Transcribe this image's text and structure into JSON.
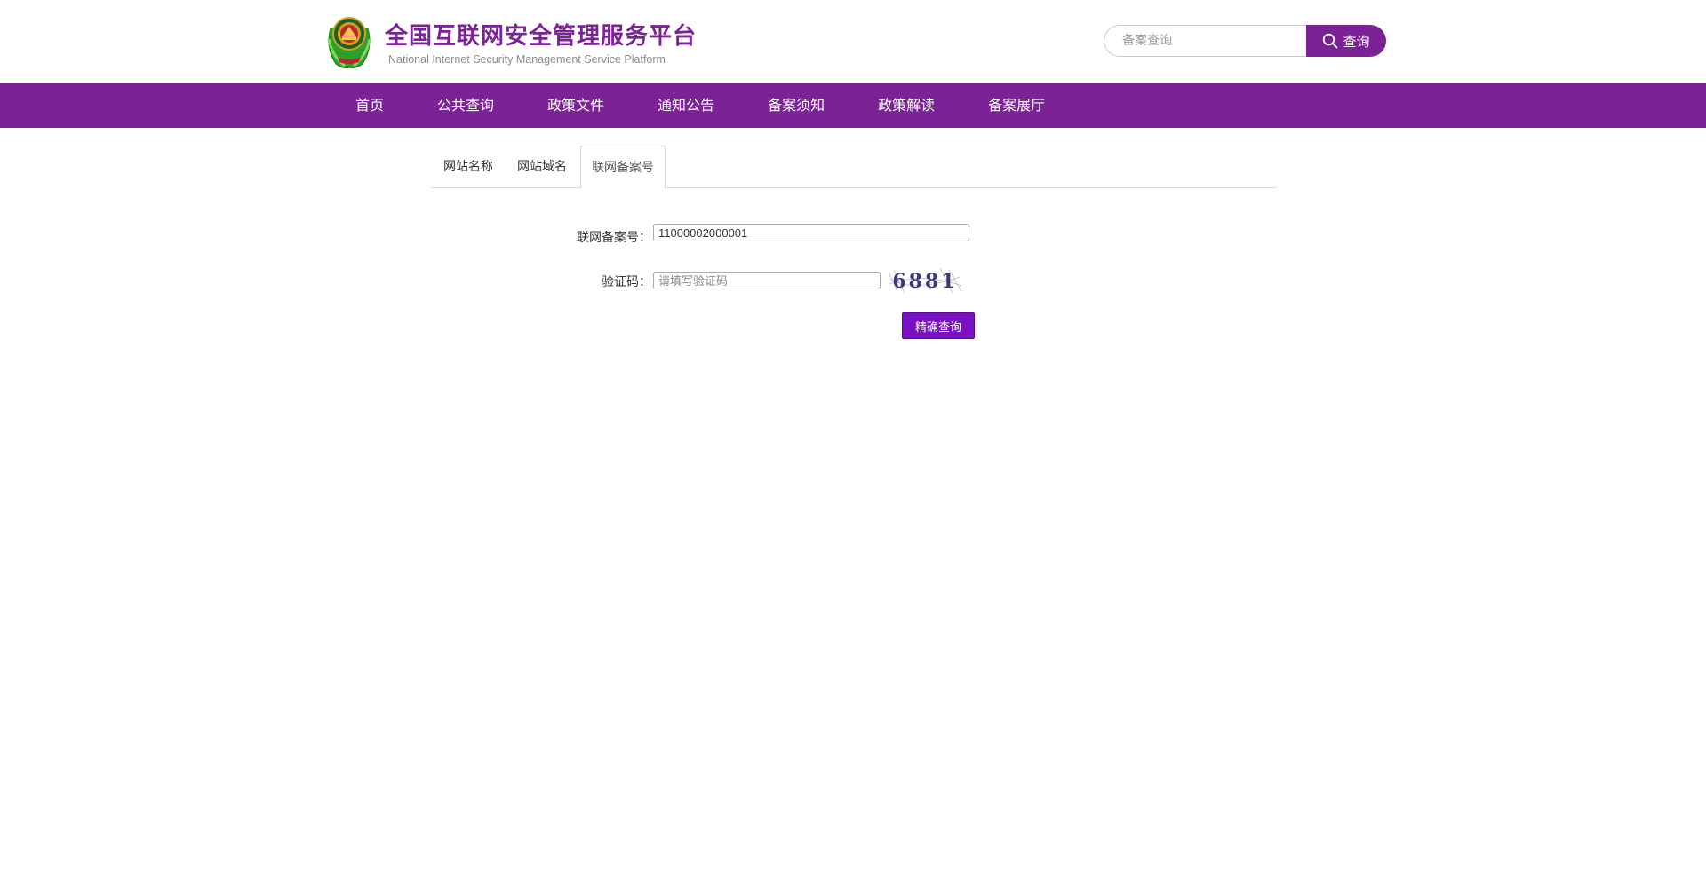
{
  "header": {
    "title": "全国互联网安全管理服务平台",
    "subtitle": "National Internet Security Management Service Platform",
    "emblem_icon": "police-emblem-icon",
    "search": {
      "placeholder": "备案查询",
      "button_label": "查询",
      "icon": "search-icon"
    }
  },
  "nav": {
    "items": [
      {
        "label": "首页"
      },
      {
        "label": "公共查询"
      },
      {
        "label": "政策文件"
      },
      {
        "label": "通知公告"
      },
      {
        "label": "备案须知"
      },
      {
        "label": "政策解读"
      },
      {
        "label": "备案展厅"
      }
    ]
  },
  "tabs": {
    "items": [
      {
        "label": "网站名称",
        "active": false
      },
      {
        "label": "网站域名",
        "active": false
      },
      {
        "label": "联网备案号",
        "active": true
      }
    ]
  },
  "form": {
    "record_label": "联网备案号：",
    "record_value": "11000002000001",
    "captcha_label": "验证码：",
    "captcha_placeholder": "请填写验证码",
    "captcha_text": "6881",
    "submit_label": "精确查询"
  },
  "colors": {
    "brand_purple": "#7a2296",
    "button_purple": "#7a10c4"
  }
}
